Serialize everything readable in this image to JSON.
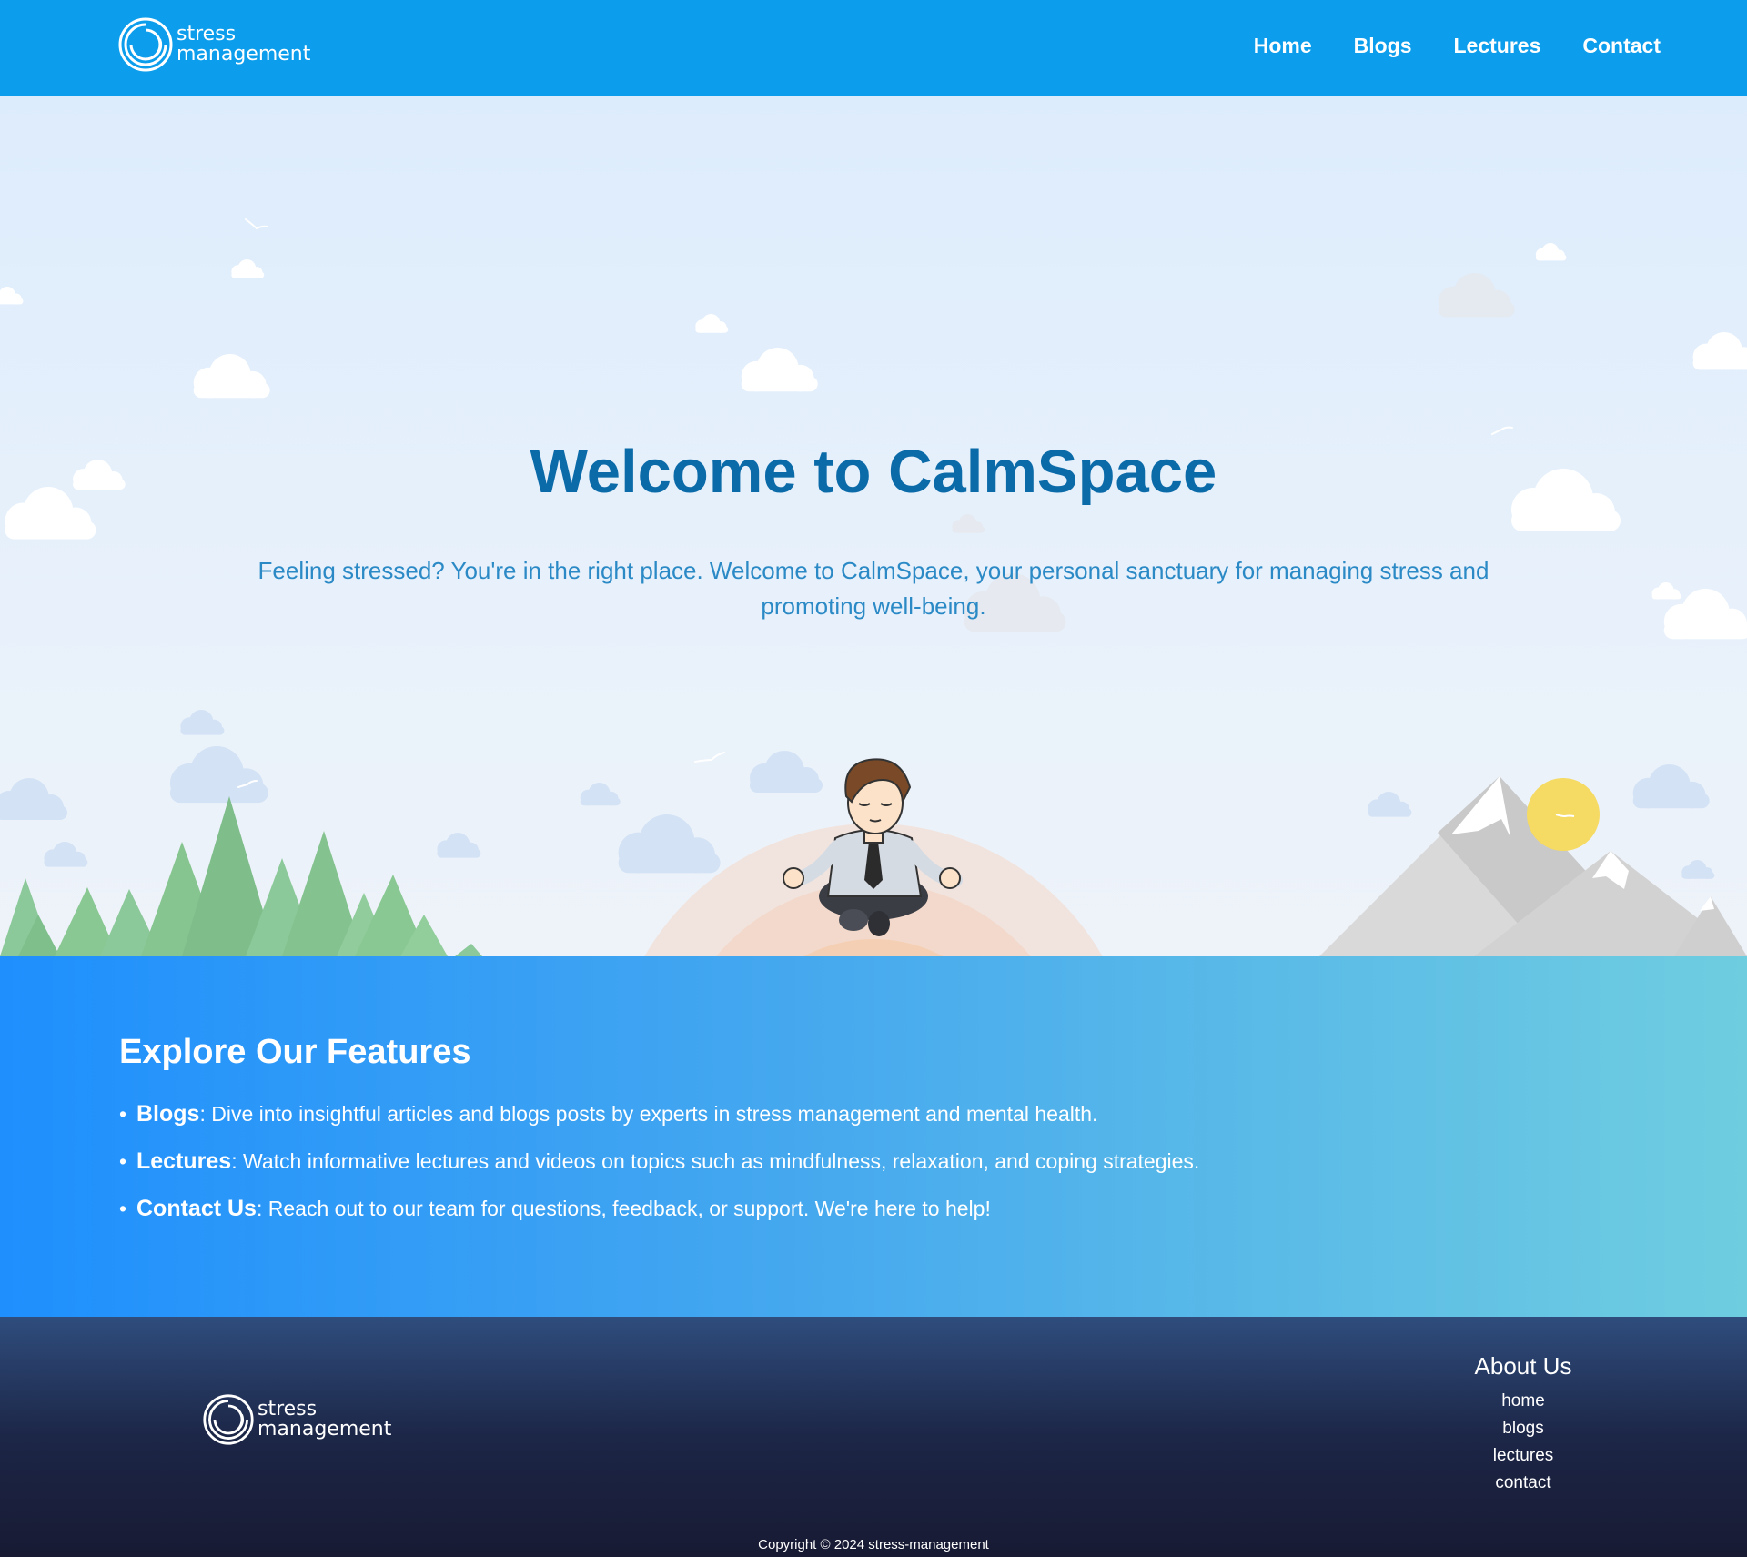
{
  "brand": {
    "line1": "stress",
    "line2": "management"
  },
  "nav": {
    "items": [
      "Home",
      "Blogs",
      "Lectures",
      "Contact"
    ]
  },
  "hero": {
    "title": "Welcome to CalmSpace",
    "subtitle": "Feeling stressed? You're in the right place. Welcome to CalmSpace, your personal sanctuary for managing stress and promoting well-being."
  },
  "features": {
    "title": "Explore Our Features",
    "items": [
      {
        "name": "Blogs",
        "desc": ": Dive into insightful articles and blogs posts by experts in stress management and mental health."
      },
      {
        "name": "Lectures",
        "desc": ": Watch informative lectures and videos on topics such as mindfulness, relaxation, and coping strategies."
      },
      {
        "name": "Contact Us",
        "desc": ": Reach out to our team for questions, feedback, or support. We're here to help!"
      }
    ]
  },
  "footer": {
    "about_title": "About Us",
    "links": [
      "home",
      "blogs",
      "lectures",
      "contact"
    ],
    "copyright": "Copyright © 2024 stress-management"
  },
  "icons": {
    "logo": "spiral-logo-icon",
    "bullet": "bullet-dot-icon"
  },
  "colors": {
    "nav_bg": "#0c9eec",
    "title": "#0b6aa8",
    "subtitle": "#2b8ac6",
    "features_start": "#1e8ffd",
    "features_end": "#6fcde0",
    "footer_top": "#2f4d7d",
    "footer_bottom": "#181a33"
  }
}
